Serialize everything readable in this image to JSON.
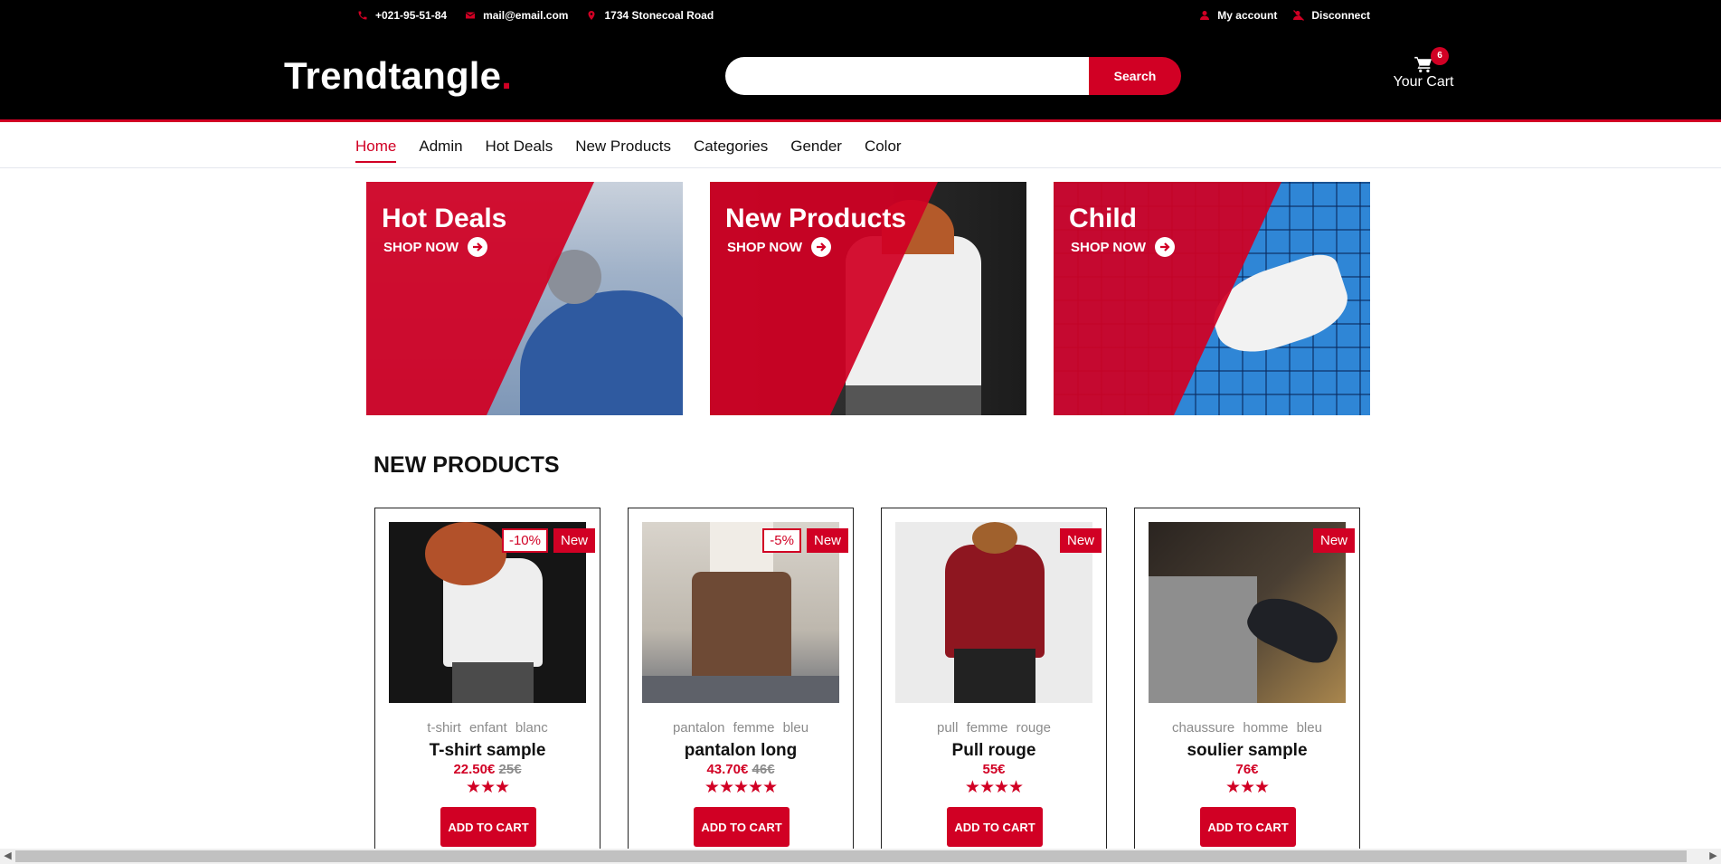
{
  "header": {
    "phone": "+021-95-51-84",
    "email": "mail@email.com",
    "address": "1734 Stonecoal Road",
    "account_label": "My account",
    "disconnect_label": "Disconnect",
    "logo_text": "Trendtangle",
    "logo_dot": ".",
    "search_placeholder": "",
    "search_button": "Search",
    "cart_count": "6",
    "cart_label": "Your Cart"
  },
  "nav": {
    "items": [
      "Home",
      "Admin",
      "Hot Deals",
      "New Products",
      "Categories",
      "Gender",
      "Color"
    ],
    "active": "Home"
  },
  "banners": [
    {
      "title": "Hot Deals",
      "cta": "SHOP NOW"
    },
    {
      "title": "New Products",
      "cta": "SHOP NOW"
    },
    {
      "title": "Child",
      "cta": "SHOP NOW"
    }
  ],
  "section_title": "NEW PRODUCTS",
  "products": [
    {
      "discount": "-10%",
      "badge": "New",
      "category": "t-shirt enfant blanc",
      "name": "T-shirt sample",
      "price": "22.50€",
      "old_price": "25€",
      "rating": 3,
      "stars": "★★★",
      "cta": "ADD TO CART"
    },
    {
      "discount": "-5%",
      "badge": "New",
      "category": "pantalon femme bleu",
      "name": "pantalon long",
      "price": "43.70€",
      "old_price": "46€",
      "rating": 5,
      "stars": "★★★★★",
      "cta": "ADD TO CART"
    },
    {
      "discount": "",
      "badge": "New",
      "category": "pull femme rouge",
      "name": "Pull rouge",
      "price": "55€",
      "old_price": "",
      "rating": 4,
      "stars": "★★★★",
      "cta": "ADD TO CART"
    },
    {
      "discount": "",
      "badge": "New",
      "category": "chaussure homme bleu",
      "name": "soulier sample",
      "price": "76€",
      "old_price": "",
      "rating": 3,
      "stars": "★★★",
      "cta": "ADD TO CART"
    }
  ],
  "colors": {
    "accent": "#d10024",
    "header_bg": "#000000"
  }
}
